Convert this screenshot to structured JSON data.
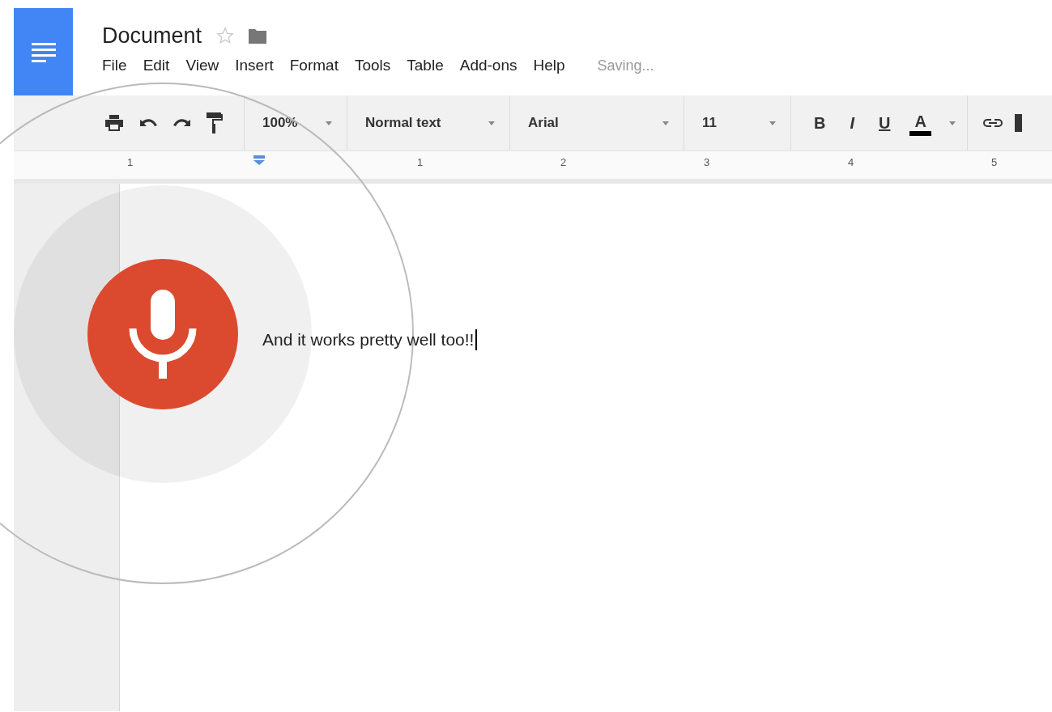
{
  "document": {
    "title": "Document",
    "starred": false
  },
  "menu": [
    "File",
    "Edit",
    "View",
    "Insert",
    "Format",
    "Tools",
    "Table",
    "Add-ons",
    "Help"
  ],
  "status": "Saving...",
  "toolbar": {
    "zoom": "100%",
    "style": "Normal text",
    "font": "Arial",
    "size": "11",
    "format_buttons": [
      {
        "label": "B",
        "kind": "bold"
      },
      {
        "label": "I",
        "kind": "italic"
      },
      {
        "label": "U",
        "kind": "underline"
      },
      {
        "label": "A",
        "kind": "color",
        "color": "#000000"
      }
    ]
  },
  "ruler": [
    "1",
    "1",
    "2",
    "3",
    "4",
    "5"
  ],
  "body": {
    "text": "And it works pretty well too!!"
  }
}
